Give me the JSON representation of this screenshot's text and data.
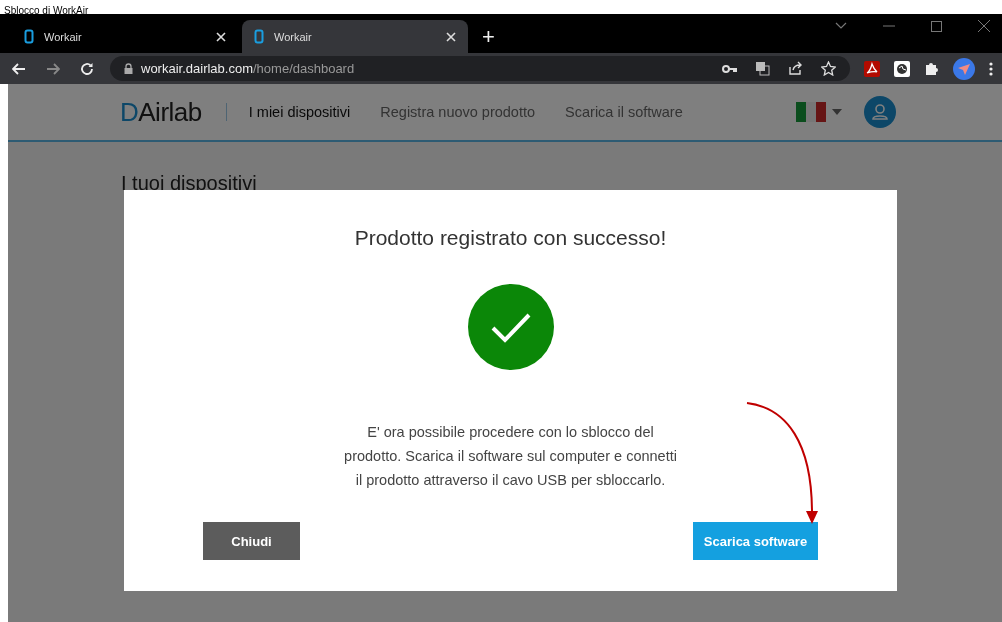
{
  "document_heading": "Sblocco di WorkAir",
  "browser": {
    "tabs": [
      {
        "title": "Workair",
        "selected": false
      },
      {
        "title": "Workair",
        "selected": true
      }
    ],
    "new_tab": "+",
    "address": {
      "host": "workair.dairlab.com",
      "path": "/home/dashboard"
    }
  },
  "site": {
    "logo": "DAirlab",
    "nav": [
      {
        "label": "I miei dispositivi",
        "selected": true
      },
      {
        "label": "Registra nuovo prodotto",
        "selected": false
      },
      {
        "label": "Scarica il software",
        "selected": false
      }
    ],
    "page_title": "I tuoi dispositivi"
  },
  "modal": {
    "title": "Prodotto registrato con successo!",
    "message_lines": [
      "E' ora possibile procedere con lo sblocco del",
      "prodotto. Scarica il software sul computer e connetti",
      "il prodotto attraverso il cavo USB per sbloccarlo."
    ],
    "buttons": [
      {
        "label": "Chiudi",
        "kind": "secondary"
      },
      {
        "label": "Scarica software",
        "kind": "primary"
      }
    ]
  }
}
